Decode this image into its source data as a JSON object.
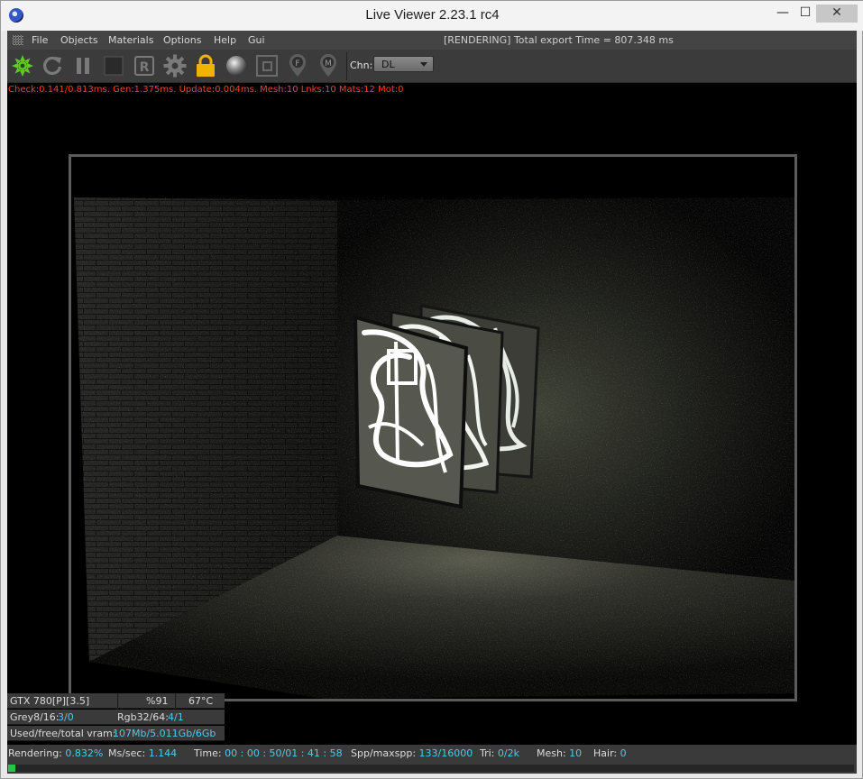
{
  "window": {
    "title": "Live Viewer 2.23.1 rc4",
    "controls": {
      "minimize": "—",
      "maximize": "☐",
      "close": "✕"
    }
  },
  "menubar": {
    "items": [
      "File",
      "Objects",
      "Materials",
      "Options",
      "Help",
      "Gui"
    ],
    "status": "[RENDERING] Total export Time = 807.348 ms"
  },
  "toolbar": {
    "buttons": [
      "octane-logo-icon",
      "restart-render-icon",
      "pause-render-icon",
      "stop-render-icon",
      "region-render-icon",
      "settings-gear-icon",
      "lock-icon",
      "material-sphere-icon",
      "clay-mode-icon",
      "focus-picker-icon",
      "material-picker-icon"
    ],
    "channel_label": "Chn:",
    "channel_value": "DL"
  },
  "perf_line": "Check:0.141/0.813ms. Gen:1.375ms. Update:0.004ms. Mesh:10 Lnks:10 Mats:12 Mot:0",
  "gpu": {
    "name": "GTX 780[P][3.5]",
    "usage": "%91",
    "temp": "67°C",
    "grey_label": "Grey8/16:",
    "grey_value": "3/0",
    "rgb_label": "Rgb32/64:",
    "rgb_value": "4/1",
    "vram_label": "Used/free/total vram:",
    "vram_value": "107Mb/5.011Gb/6Gb"
  },
  "status": {
    "rendering_label": "Rendering:",
    "rendering_value": "0.832%",
    "mssec_label": "Ms/sec:",
    "mssec_value": "1.144",
    "time_label": "Time:",
    "time_value": "00 : 00 : 50/01 : 41 : 58",
    "spp_label": "Spp/maxspp:",
    "spp_value": "133/16000",
    "tri_label": "Tri:",
    "tri_value": "0/2k",
    "mesh_label": "Mesh:",
    "mesh_value": "10",
    "hair_label": "Hair:",
    "hair_value": "0"
  },
  "progress_fraction": 0.00832,
  "colors": {
    "accent_value": "#53c8e8",
    "perf_text": "#ff3b24",
    "progress_fill": "#22c64b",
    "logo_green": "#5fcb2a",
    "lock_gold": "#f0b400"
  }
}
